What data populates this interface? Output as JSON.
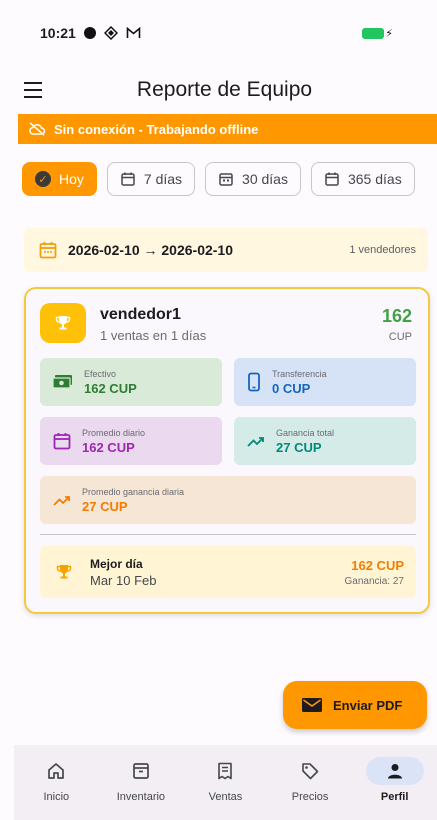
{
  "status_bar": {
    "time": "10:21"
  },
  "app_bar": {
    "title": "Reporte de Equipo"
  },
  "offline_banner": {
    "text": "Sin conexión - Trabajando offline"
  },
  "filters": [
    {
      "label": "Hoy",
      "active": true
    },
    {
      "label": "7 días",
      "active": false
    },
    {
      "label": "30 días",
      "active": false
    },
    {
      "label": "365 días",
      "active": false
    }
  ],
  "date_range": {
    "text": "2026-02-10 → 2026-02-10",
    "sellers_count": "1 vendedores"
  },
  "seller_card": {
    "name": "vendedor1",
    "subtitle": "1 ventas en 1 días",
    "total": "162",
    "currency": "CUP",
    "stats": {
      "efectivo": {
        "label": "Efectivo",
        "value": "162 CUP",
        "color": "#2e7d32"
      },
      "transferencia": {
        "label": "Transferencia",
        "value": "0 CUP",
        "color": "#1565c0"
      },
      "promedio_diario": {
        "label": "Promedio diario",
        "value": "162 CUP",
        "color": "#9c27b0"
      },
      "ganancia_total": {
        "label": "Ganancia total",
        "value": "27 CUP",
        "color": "#00897b"
      },
      "promedio_ganancia": {
        "label": "Promedio ganancia diaria",
        "value": "27 CUP",
        "color": "#f57c00"
      }
    },
    "best_day": {
      "label": "Mejor día",
      "date": "Mar 10 Feb",
      "amount": "162 CUP",
      "gain": "Ganancia: 27"
    }
  },
  "fab": {
    "label": "Enviar PDF"
  },
  "bottom_nav": [
    {
      "label": "Inicio",
      "icon": "home-icon"
    },
    {
      "label": "Inventario",
      "icon": "archive-icon"
    },
    {
      "label": "Ventas",
      "icon": "receipt-icon"
    },
    {
      "label": "Precios",
      "icon": "tag-icon"
    },
    {
      "label": "Perfil",
      "icon": "person-icon",
      "active": true
    }
  ],
  "colors": {
    "accent": "#ff9800",
    "gold": "#ffc107",
    "total_green": "#43a047"
  }
}
